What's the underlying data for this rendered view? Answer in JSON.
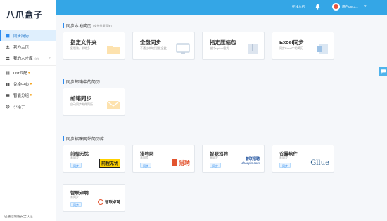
{
  "app": {
    "logo": "八爪盒子"
  },
  "sidebar": {
    "items": [
      {
        "label": "同步简历",
        "icon": "sync-icon",
        "active": true
      },
      {
        "label": "我的主页",
        "icon": "user-icon"
      },
      {
        "label": "我的人才库",
        "icon": "people-icon",
        "count": "(0)"
      },
      {
        "label": "List匹配",
        "icon": "grid-icon",
        "dot": "●"
      },
      {
        "label": "兑换中心",
        "icon": "gift-icon",
        "dot": "●"
      },
      {
        "label": "智能分组",
        "icon": "group-icon",
        "dot": "●"
      },
      {
        "label": "小猎手",
        "icon": "hunter-icon"
      }
    ],
    "footer": "已通过网盾安全认证"
  },
  "header": {
    "nav_link": "在线介绍",
    "username": "用户0843..."
  },
  "sections": {
    "local": {
      "title": "同步本地简历",
      "note": "(支持批量添加)"
    },
    "email": {
      "title": "同步邮箱中的简历"
    },
    "sites": {
      "title": "同步招聘网站简历库"
    }
  },
  "local_cards": [
    {
      "title": "指定文件夹",
      "sub": "复制该，新增多",
      "icon": "folder-icon"
    },
    {
      "title": "全盘同步",
      "sub": "不通过本地扫描(全盘)",
      "icon": "monitor-icon"
    },
    {
      "title": "指定压缩包",
      "sub": "支持zip/rar格式",
      "icon": "zip-icon"
    },
    {
      "title": "Excel同步",
      "sub": "同步Excel中的简历",
      "icon": "excel-icon"
    }
  ],
  "email_card": {
    "title": "邮箱同步",
    "sub": "自动同步邮件简历",
    "icon": "mail-icon"
  },
  "site_cards": [
    {
      "name": "前程无忧",
      "status": "未同步",
      "button": "同步",
      "logo_text": "前程无忧",
      "logo_sub": "51job.com"
    },
    {
      "name": "猎聘网",
      "status": "未同步",
      "button": "同步",
      "logo_text": "猎聘"
    },
    {
      "name": "智联招聘",
      "status": "未同步",
      "button": "同步",
      "logo_text": "智联招聘",
      "logo_sub": "zhaopin.com"
    },
    {
      "name": "谷露软件",
      "status": "未同步",
      "button": "同步",
      "logo_text": "Gllue"
    },
    {
      "name": "智联卓聘",
      "status": "未同步",
      "button": "同步",
      "logo_text": "智联卓聘"
    }
  ],
  "colors": {
    "header": "#34a6e6",
    "accent": "#2d8cf0",
    "active_bg": "#dfeffd"
  }
}
